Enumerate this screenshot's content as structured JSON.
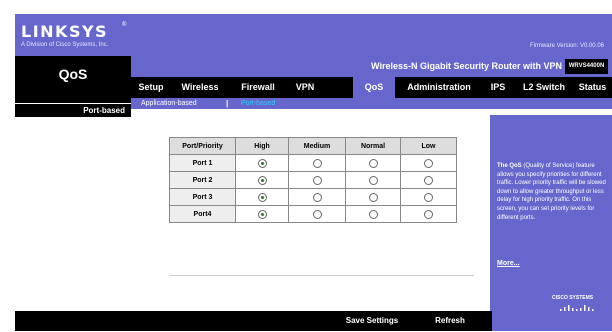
{
  "brand": {
    "logo_text": "LINKSYS",
    "logo_registered": "®",
    "tagline": "A Division of Cisco Systems, Inc.",
    "firmware_version": "Firmware Version: V0.00.06"
  },
  "left_panel": {
    "title": "QoS",
    "section_header": "Port-based"
  },
  "product": {
    "name": "Wireless-N Gigabit Security Router with VPN",
    "model": "WRVS4400N"
  },
  "nav": {
    "tabs": [
      {
        "label": "Setup",
        "active": false
      },
      {
        "label": "Wireless",
        "active": false
      },
      {
        "label": "Firewall",
        "active": false
      },
      {
        "label": "VPN",
        "active": false
      },
      {
        "label": "QoS",
        "active": true
      },
      {
        "label": "Administration",
        "active": false
      },
      {
        "label": "IPS",
        "active": false
      },
      {
        "label": "L2 Switch",
        "active": false
      },
      {
        "label": "Status",
        "active": false
      }
    ],
    "sub_items": [
      {
        "label": "Application-based",
        "active": false
      },
      {
        "label": "Port-based",
        "active": true
      }
    ],
    "sub_separator": "|"
  },
  "port_table": {
    "headers": [
      "Port/Priority",
      "High",
      "Medium",
      "Normal",
      "Low"
    ],
    "rows": [
      {
        "port": "Port 1",
        "selected": "High"
      },
      {
        "port": "Port 2",
        "selected": "High"
      },
      {
        "port": "Port 3",
        "selected": "High"
      },
      {
        "port": "Port4",
        "selected": "High"
      }
    ]
  },
  "help": {
    "title": "The QoS",
    "text": " (Quality of Service) feature allows you specify priorities for different traffic. Lower priority traffic will be slowed down to allow greater throughput or less delay for high priority traffic. On this screen, you can set priority levels for different ports.",
    "more_link": "More..."
  },
  "footer": {
    "save_label": "Save Settings",
    "refresh_label": "Refresh"
  },
  "cisco_logo": "CISCO SYSTEMS",
  "colors": {
    "brand_purple": "#6666cc",
    "accent_cyan": "#33ccff",
    "black": "#000000"
  }
}
